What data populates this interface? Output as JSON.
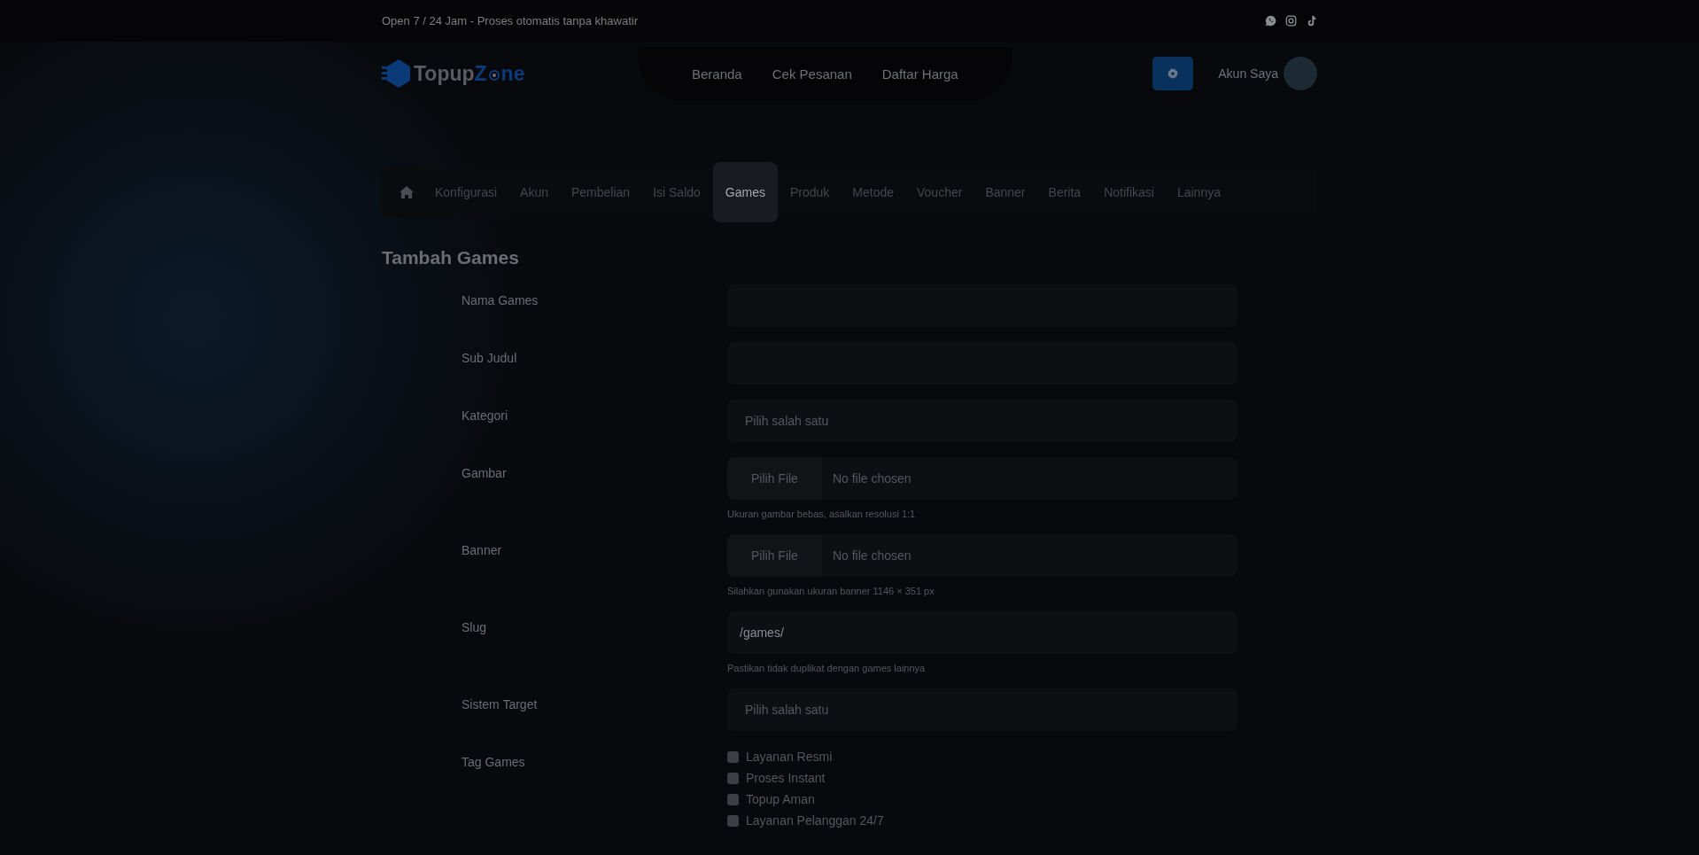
{
  "topbar": {
    "text": "Open 7 / 24 Jam - Proses otomatis tanpa khawatir"
  },
  "header": {
    "logo": {
      "part_1": "Topup",
      "part_2": "Z",
      "part_3": "ne"
    },
    "nav": [
      "Beranda",
      "Cek Pesanan",
      "Daftar Harga"
    ],
    "account": "Akun Saya"
  },
  "tabs": [
    {
      "label": "Konfigurasi",
      "selected": false
    },
    {
      "label": "Akun",
      "selected": false
    },
    {
      "label": "Pembelian",
      "selected": false
    },
    {
      "label": "Isi Saldo",
      "selected": false
    },
    {
      "label": "Games",
      "selected": true
    },
    {
      "label": "Produk",
      "selected": false
    },
    {
      "label": "Metode",
      "selected": false
    },
    {
      "label": "Voucher",
      "selected": false
    },
    {
      "label": "Banner",
      "selected": false
    },
    {
      "label": "Berita",
      "selected": false
    },
    {
      "label": "Notifikasi",
      "selected": false
    },
    {
      "label": "Lainnya",
      "selected": false
    }
  ],
  "page_title": "Tambah Games",
  "form": [
    {
      "kind": "text",
      "label": "Nama Games"
    },
    {
      "kind": "text",
      "label": "Sub Judul"
    },
    {
      "kind": "select",
      "label": "Kategori",
      "placeholder": "Pilih salah satu"
    },
    {
      "kind": "file",
      "label": "Gambar",
      "button": "Pilih File",
      "status": "No file chosen",
      "help": "Ukuran gambar bebas, asalkan resolusi 1:1"
    },
    {
      "kind": "file",
      "label": "Banner",
      "button": "Pilih File",
      "status": "No file chosen",
      "help": "Silahkan gunakan ukuran banner 1146 × 351 px"
    },
    {
      "kind": "text",
      "label": "Slug",
      "value": "/games/",
      "help": "Pastikan tidak duplikat dengan games lainnya"
    },
    {
      "kind": "select",
      "label": "Sistem Target",
      "placeholder": "Pilih salah satu"
    },
    {
      "kind": "checks",
      "label": "Tag Games",
      "options": [
        {
          "label": "Layanan Resmi",
          "checked": false
        },
        {
          "label": "Proses Instant",
          "checked": false
        },
        {
          "label": "Topup Aman",
          "checked": false
        },
        {
          "label": "Layanan Pelanggan 24/7",
          "checked": false
        }
      ]
    }
  ]
}
